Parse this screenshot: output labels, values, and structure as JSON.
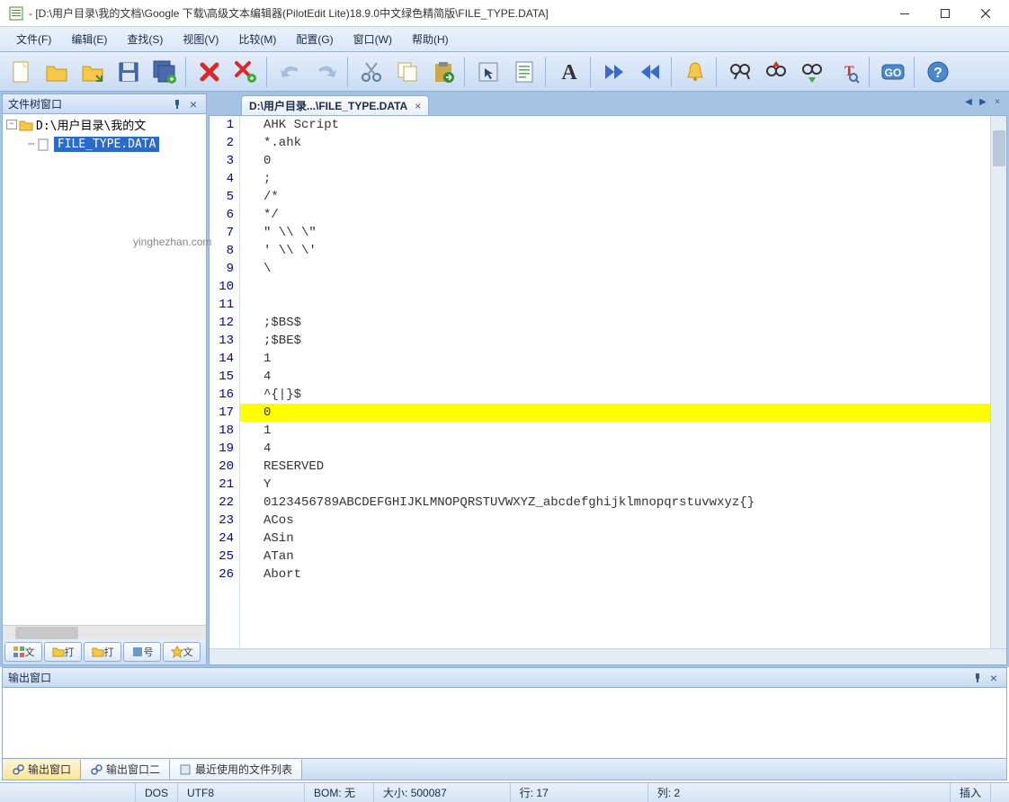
{
  "window": {
    "title": " - [D:\\用户目录\\我的文档\\Google 下载\\高级文本编辑器(PilotEdit Lite)18.9.0中文绿色精简版\\FILE_TYPE.DATA]"
  },
  "menu": {
    "file": "文件(F)",
    "edit": "编辑(E)",
    "search": "查找(S)",
    "view": "视图(V)",
    "compare": "比较(M)",
    "config": "配置(G)",
    "window": "窗口(W)",
    "help": "帮助(H)"
  },
  "left_panel": {
    "title": "文件树窗口",
    "root_label": "D:\\用户目录\\我的文",
    "file_label": "FILE_TYPE.DATA",
    "tab1": "文",
    "tab2": "打",
    "tab3": "打",
    "tab4": "号",
    "tab5": "文"
  },
  "editor": {
    "tab_label": "D:\\用户目录...\\FILE_TYPE.DATA",
    "highlight_line": 17,
    "lines": [
      "AHK Script",
      "*.ahk",
      "0",
      ";",
      "/*",
      "*/",
      "\" \\\\ \\\"",
      "' \\\\ \\'",
      "\\",
      "",
      "",
      ";$BS$",
      ";$BE$",
      "1",
      "4",
      "^{|}$",
      "0",
      "1",
      "4",
      "RESERVED",
      "Y",
      "0123456789ABCDEFGHIJKLMNOPQRSTUVWXYZ_abcdefghijklmnopqrstuvwxyz{}",
      "ACos",
      "ASin",
      "ATan",
      "Abort"
    ]
  },
  "output": {
    "title": "输出窗口",
    "tab1": "输出窗口",
    "tab2": "输出窗口二",
    "tab3": "最近使用的文件列表"
  },
  "status": {
    "s1": "DOS",
    "s2": "UTF8",
    "s3": "BOM: 无",
    "s4": "大小: 500087",
    "s5": "行: 17",
    "s6": "列: 2",
    "s7": "插入"
  },
  "watermark": "yinghezhan.com"
}
